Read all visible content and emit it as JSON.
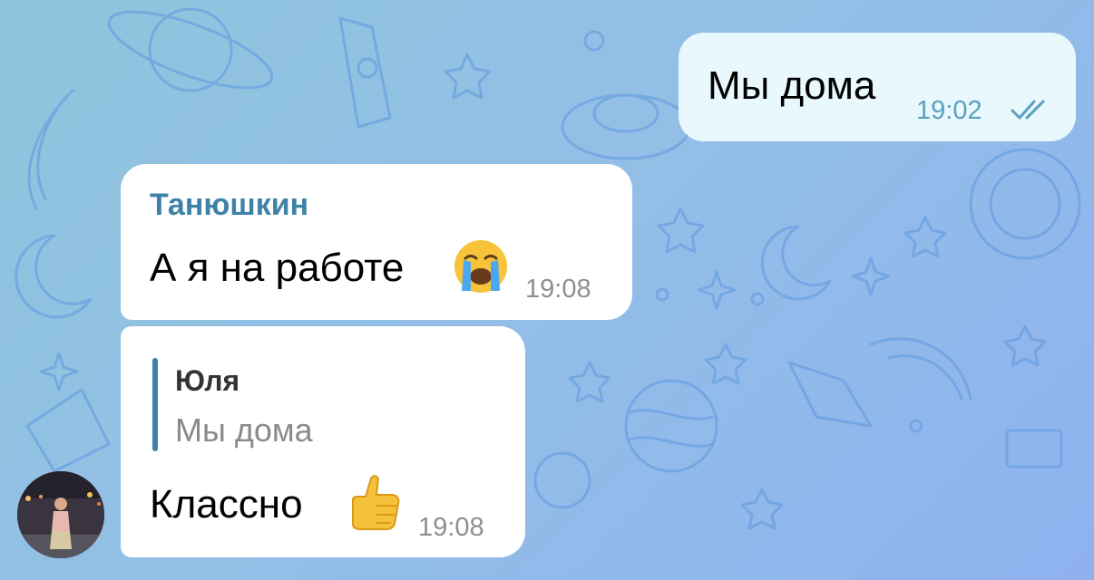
{
  "chat": {
    "messages": [
      {
        "direction": "outgoing",
        "text": "Мы дома",
        "time": "19:02",
        "status": "read"
      },
      {
        "direction": "incoming",
        "sender": "Танюшкин",
        "text": "А я на работе",
        "emoji": "loudly-crying-face",
        "time": "19:08"
      },
      {
        "direction": "incoming",
        "reply": {
          "name": "Юля",
          "text": "Мы дома"
        },
        "text": "Классно",
        "emoji": "thumbs-up",
        "time": "19:08"
      }
    ]
  },
  "colors": {
    "background": "#93bfe6",
    "outgoing_bubble": "#e9f8fd",
    "incoming_bubble": "#ffffff",
    "sender_name": "#3f82a8",
    "reply_bar": "#3f82a8",
    "time_outgoing": "#5a9fbd",
    "time_incoming": "#8e8e93"
  },
  "icons": {
    "read_status": "double-check-icon",
    "avatar": "user-avatar-photo"
  }
}
